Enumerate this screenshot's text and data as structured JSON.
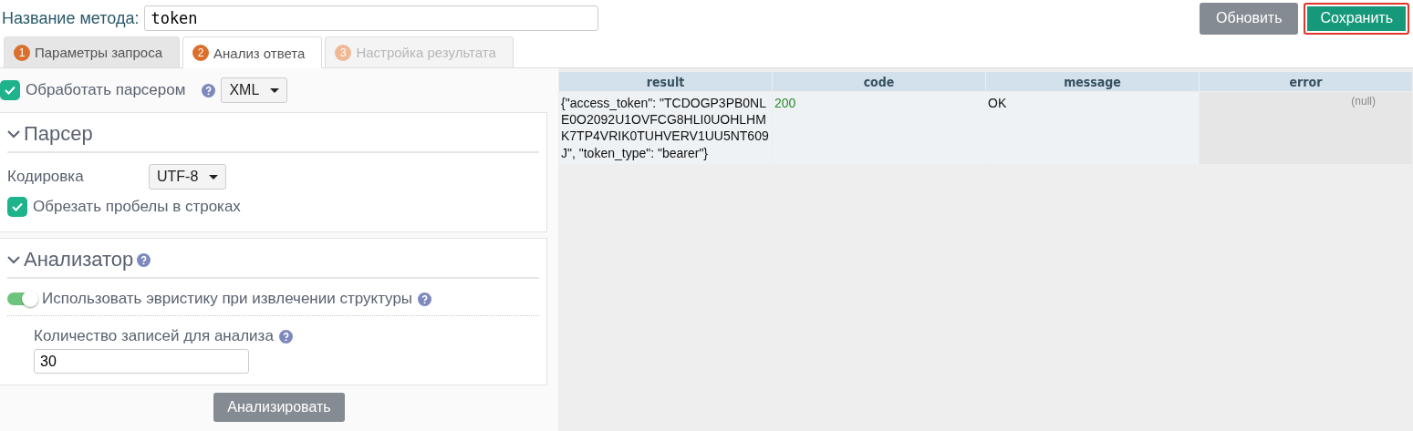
{
  "method": {
    "label": "Название метода:",
    "value": "token"
  },
  "buttons": [
    {
      "label": "Обновить",
      "kind": "secondary",
      "highlighted": false
    },
    {
      "label": "Сохранить",
      "kind": "primary",
      "highlighted": true
    }
  ],
  "tabs": [
    {
      "number": "1",
      "label": "Параметры запроса",
      "selected": false,
      "disabled": false
    },
    {
      "number": "2",
      "label": "Анализ ответа",
      "selected": true,
      "disabled": false
    },
    {
      "number": "3",
      "label": "Настройка результата",
      "selected": false,
      "disabled": true
    }
  ],
  "parser_toggle": {
    "label": "Обработать парсером",
    "checked": true,
    "format": "XML"
  },
  "parser": {
    "title": "Парсер",
    "expanded": true,
    "encoding_label": "Кодировка",
    "encoding": "UTF-8",
    "trim": {
      "label": "Обрезать пробелы в строках",
      "checked": true
    }
  },
  "analyzer": {
    "title": "Анализатор",
    "expanded": true,
    "heuristic": {
      "label": "Использовать эвристику при извлечении структуры",
      "on": true
    },
    "count_label": "Количество записей для анализа",
    "count": "30"
  },
  "analyze_button": "Анализировать",
  "table": {
    "columns": [
      "result",
      "code",
      "message",
      "error"
    ],
    "rows": [
      [
        {
          "text": "{\"access_token\": \"TCDOGP3PB0NLE0O2092U1OVFCG8HLI0UOHLHMK7TP4VRIK0TUHVERV1UU5NT609J\", \"token_type\": \"bearer\"}",
          "kind": "text"
        },
        {
          "text": "200",
          "kind": "number"
        },
        {
          "text": "OK",
          "kind": "text"
        },
        {
          "text": "(null)",
          "kind": "null"
        }
      ]
    ]
  }
}
